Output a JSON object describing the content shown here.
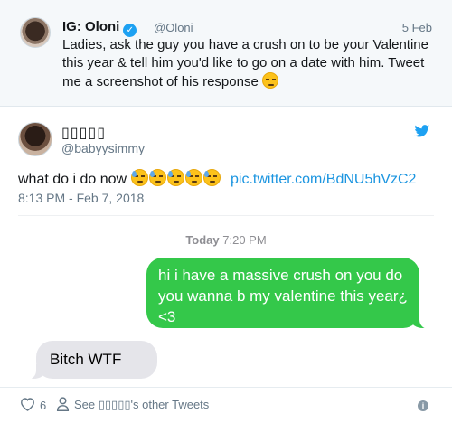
{
  "quoted": {
    "name": "IG: Oloni",
    "handle": "@Oloni",
    "date": "5 Feb",
    "text": "Ladies, ask the guy you have a crush on to be your Valentine this year & tell him you'd like to go on a date with him. Tweet me a screenshot of his response"
  },
  "tweet": {
    "name": "▯▯▯▯▯",
    "handle": "@babyysimmy",
    "text": "what do i do now",
    "link": "pic.twitter.com/BdNU5hVzC2",
    "timestamp": "8:13 PM - Feb 7, 2018"
  },
  "screenshot": {
    "day": "Today",
    "time": "7:20 PM",
    "outgoing": "hi i have a massive crush on you do you wanna b my valentine this year¿ <3",
    "incoming": "Bitch WTF"
  },
  "footer": {
    "likes": "6",
    "other_tweets": "See ▯▯▯▯▯'s other Tweets"
  },
  "colors": {
    "twitter_blue": "#1da1f2",
    "imessage_green": "#34c84a",
    "imessage_gray": "#e5e5ea"
  }
}
